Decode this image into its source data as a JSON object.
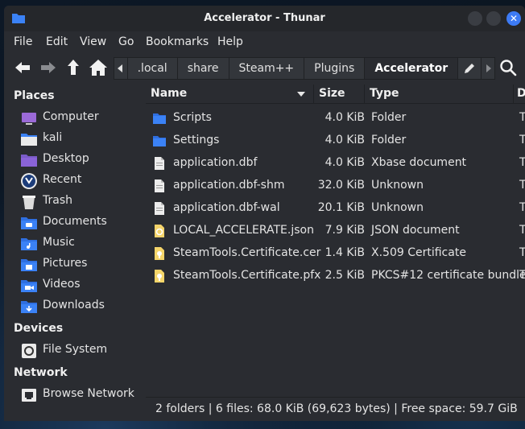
{
  "window": {
    "title": "Accelerator - Thunar"
  },
  "menu": [
    "File",
    "Edit",
    "View",
    "Go",
    "Bookmarks",
    "Help"
  ],
  "path": {
    "crumbs": [
      ".local",
      "share",
      "Steam++",
      "Plugins",
      "Accelerator"
    ],
    "active": "Accelerator"
  },
  "sidebar": {
    "places_title": "Places",
    "places": [
      {
        "label": "Computer",
        "icon": "computer-icon"
      },
      {
        "label": "kali",
        "icon": "home-folder-icon"
      },
      {
        "label": "Desktop",
        "icon": "desktop-folder-icon"
      },
      {
        "label": "Recent",
        "icon": "recent-icon"
      },
      {
        "label": "Trash",
        "icon": "trash-icon"
      },
      {
        "label": "Documents",
        "icon": "documents-folder-icon"
      },
      {
        "label": "Music",
        "icon": "music-folder-icon"
      },
      {
        "label": "Pictures",
        "icon": "pictures-folder-icon"
      },
      {
        "label": "Videos",
        "icon": "videos-folder-icon"
      },
      {
        "label": "Downloads",
        "icon": "downloads-folder-icon"
      }
    ],
    "devices_title": "Devices",
    "devices": [
      {
        "label": "File System",
        "icon": "drive-icon"
      }
    ],
    "network_title": "Network",
    "network": [
      {
        "label": "Browse Network",
        "icon": "network-icon"
      }
    ]
  },
  "columns": {
    "name": "Name",
    "size": "Size",
    "type": "Type",
    "date": "D"
  },
  "files": [
    {
      "name": "Scripts",
      "size": "4.0 KiB",
      "type": "Folder",
      "date": "T",
      "icon": "folder-icon"
    },
    {
      "name": "Settings",
      "size": "4.0 KiB",
      "type": "Folder",
      "date": "T",
      "icon": "folder-icon"
    },
    {
      "name": "application.dbf",
      "size": "4.0 KiB",
      "type": "Xbase document",
      "date": "T",
      "icon": "file-icon"
    },
    {
      "name": "application.dbf-shm",
      "size": "32.0 KiB",
      "type": "Unknown",
      "date": "T",
      "icon": "file-icon"
    },
    {
      "name": "application.dbf-wal",
      "size": "20.1 KiB",
      "type": "Unknown",
      "date": "T",
      "icon": "file-icon"
    },
    {
      "name": "LOCAL_ACCELERATE.json",
      "size": "7.9 KiB",
      "type": "JSON document",
      "date": "T",
      "icon": "json-file-icon"
    },
    {
      "name": "SteamTools.Certificate.cer",
      "size": "1.4 KiB",
      "type": "X.509 Certificate",
      "date": "T",
      "icon": "certificate-icon"
    },
    {
      "name": "SteamTools.Certificate.pfx",
      "size": "2.5 KiB",
      "type": "PKCS#12 certificate bundle",
      "date": "T",
      "icon": "certificate-icon"
    }
  ],
  "status": "2 folders  |  6 files: 68.0 KiB (69,623 bytes)  |  Free space: 59.7 GiB",
  "colors": {
    "accent": "#3d7bf5",
    "folder": "#3b82f6",
    "window_bg": "#2a2c31"
  }
}
